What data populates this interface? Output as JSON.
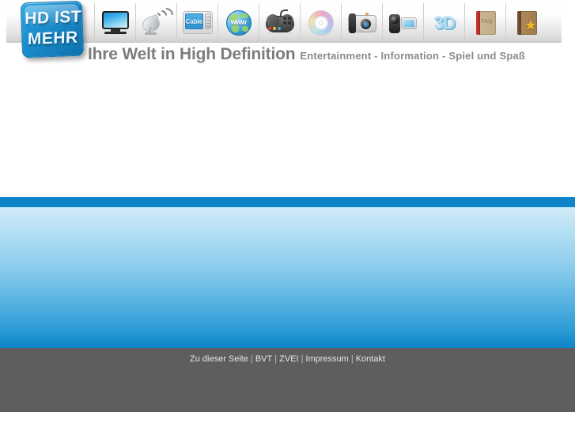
{
  "site": {
    "logo_lines": [
      "HD IST",
      "MEHR"
    ],
    "tagline_main": "Ihre Welt in High Definition",
    "tagline_sub": "Entertainment  -  Information  -  Spiel und Spaß"
  },
  "nav_icons": [
    {
      "name": "tv-icon",
      "label": "TV"
    },
    {
      "name": "satellite-dish-icon",
      "label": "Satellit"
    },
    {
      "name": "cable-box-icon",
      "label": "Cable",
      "screen_text": "Cable"
    },
    {
      "name": "globe-www-icon",
      "label": "WWW",
      "screen_text": "www"
    },
    {
      "name": "gamepad-icon",
      "label": "Spiele"
    },
    {
      "name": "disc-icon",
      "label": "Blu-ray"
    },
    {
      "name": "photo-camera-icon",
      "label": "Foto"
    },
    {
      "name": "camcorder-icon",
      "label": "Camcorder"
    },
    {
      "name": "three-d-icon",
      "label": "3D",
      "screen_text": "3D"
    },
    {
      "name": "faq-book-icon",
      "label": "FAQ",
      "screen_text": "FAQ"
    },
    {
      "name": "favorites-book-icon",
      "label": "Favoriten"
    }
  ],
  "footer": {
    "links": [
      "Zu dieser Seite",
      "BVT",
      "ZVEI",
      "Impressum",
      "Kontakt"
    ],
    "separator": "|"
  },
  "colors": {
    "accent_blue": "#0d85c8",
    "footer_gray": "#5e5e5e",
    "tagline_gray": "#7c7c7c"
  }
}
